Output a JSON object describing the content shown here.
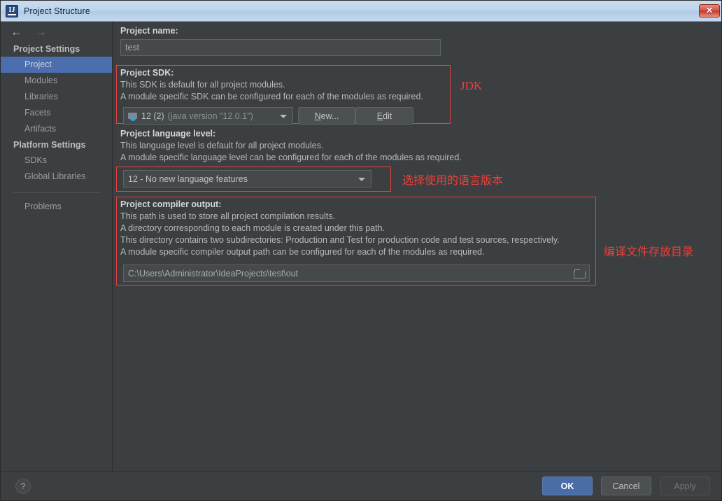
{
  "window": {
    "title": "Project Structure",
    "app_icon": "intellij-idea-icon",
    "close_label": "✕"
  },
  "nav": {
    "back_icon": "←",
    "forward_icon": "→"
  },
  "sidebar": {
    "groups": [
      {
        "title": "Project Settings",
        "items": [
          {
            "label": "Project",
            "selected": true
          },
          {
            "label": "Modules",
            "selected": false
          },
          {
            "label": "Libraries",
            "selected": false
          },
          {
            "label": "Facets",
            "selected": false
          },
          {
            "label": "Artifacts",
            "selected": false
          }
        ]
      },
      {
        "title": "Platform Settings",
        "items": [
          {
            "label": "SDKs",
            "selected": false
          },
          {
            "label": "Global Libraries",
            "selected": false
          }
        ]
      }
    ],
    "extra_items": [
      {
        "label": "Problems",
        "selected": false
      }
    ]
  },
  "main": {
    "project_name": {
      "label": "Project name:",
      "value": "test"
    },
    "project_sdk": {
      "label": "Project SDK:",
      "desc_line1": "This SDK is default for all project modules.",
      "desc_line2": "A module specific SDK can be configured for each of the modules as required.",
      "combo_value": "12 (2)",
      "combo_version": "(java version \"12.0.1\")",
      "combo_icon": "java-sdk-icon",
      "new_button": "New...",
      "new_button_mnemonic": "N",
      "new_button_rest": "ew...",
      "edit_button": "Edit",
      "edit_button_mnemonic": "E",
      "edit_button_rest": "dit"
    },
    "language_level": {
      "label": "Project language level:",
      "desc_line1": "This language level is default for all project modules.",
      "desc_line2": "A module specific language level can be configured for each of the modules as required.",
      "combo_value": "12 - No new language features"
    },
    "compiler_output": {
      "label": "Project compiler output:",
      "desc_line1": "This path is used to store all project compilation results.",
      "desc_line2": "A directory corresponding to each module is created under this path.",
      "desc_line3": "This directory contains two subdirectories: Production and Test for production code and test sources, respectively.",
      "desc_line4": "A module specific compiler output path can be configured for each of the modules as required.",
      "value": "C:\\Users\\Administrator\\IdeaProjects\\test\\out",
      "browse_icon": "folder-browse-icon"
    }
  },
  "annotations": {
    "color": "#e8413c",
    "sdk": "JDK",
    "language_level": "选择使用的语言版本",
    "compiler_output": "编译文件存放目录"
  },
  "footer": {
    "help_label": "?",
    "ok": "OK",
    "cancel": "Cancel",
    "apply": "Apply"
  },
  "theme": {
    "background": "#3c3f41",
    "selection_blue": "#4b6eaf",
    "primary_button": "#4a6da7",
    "annotation_red": "#e8413c"
  }
}
